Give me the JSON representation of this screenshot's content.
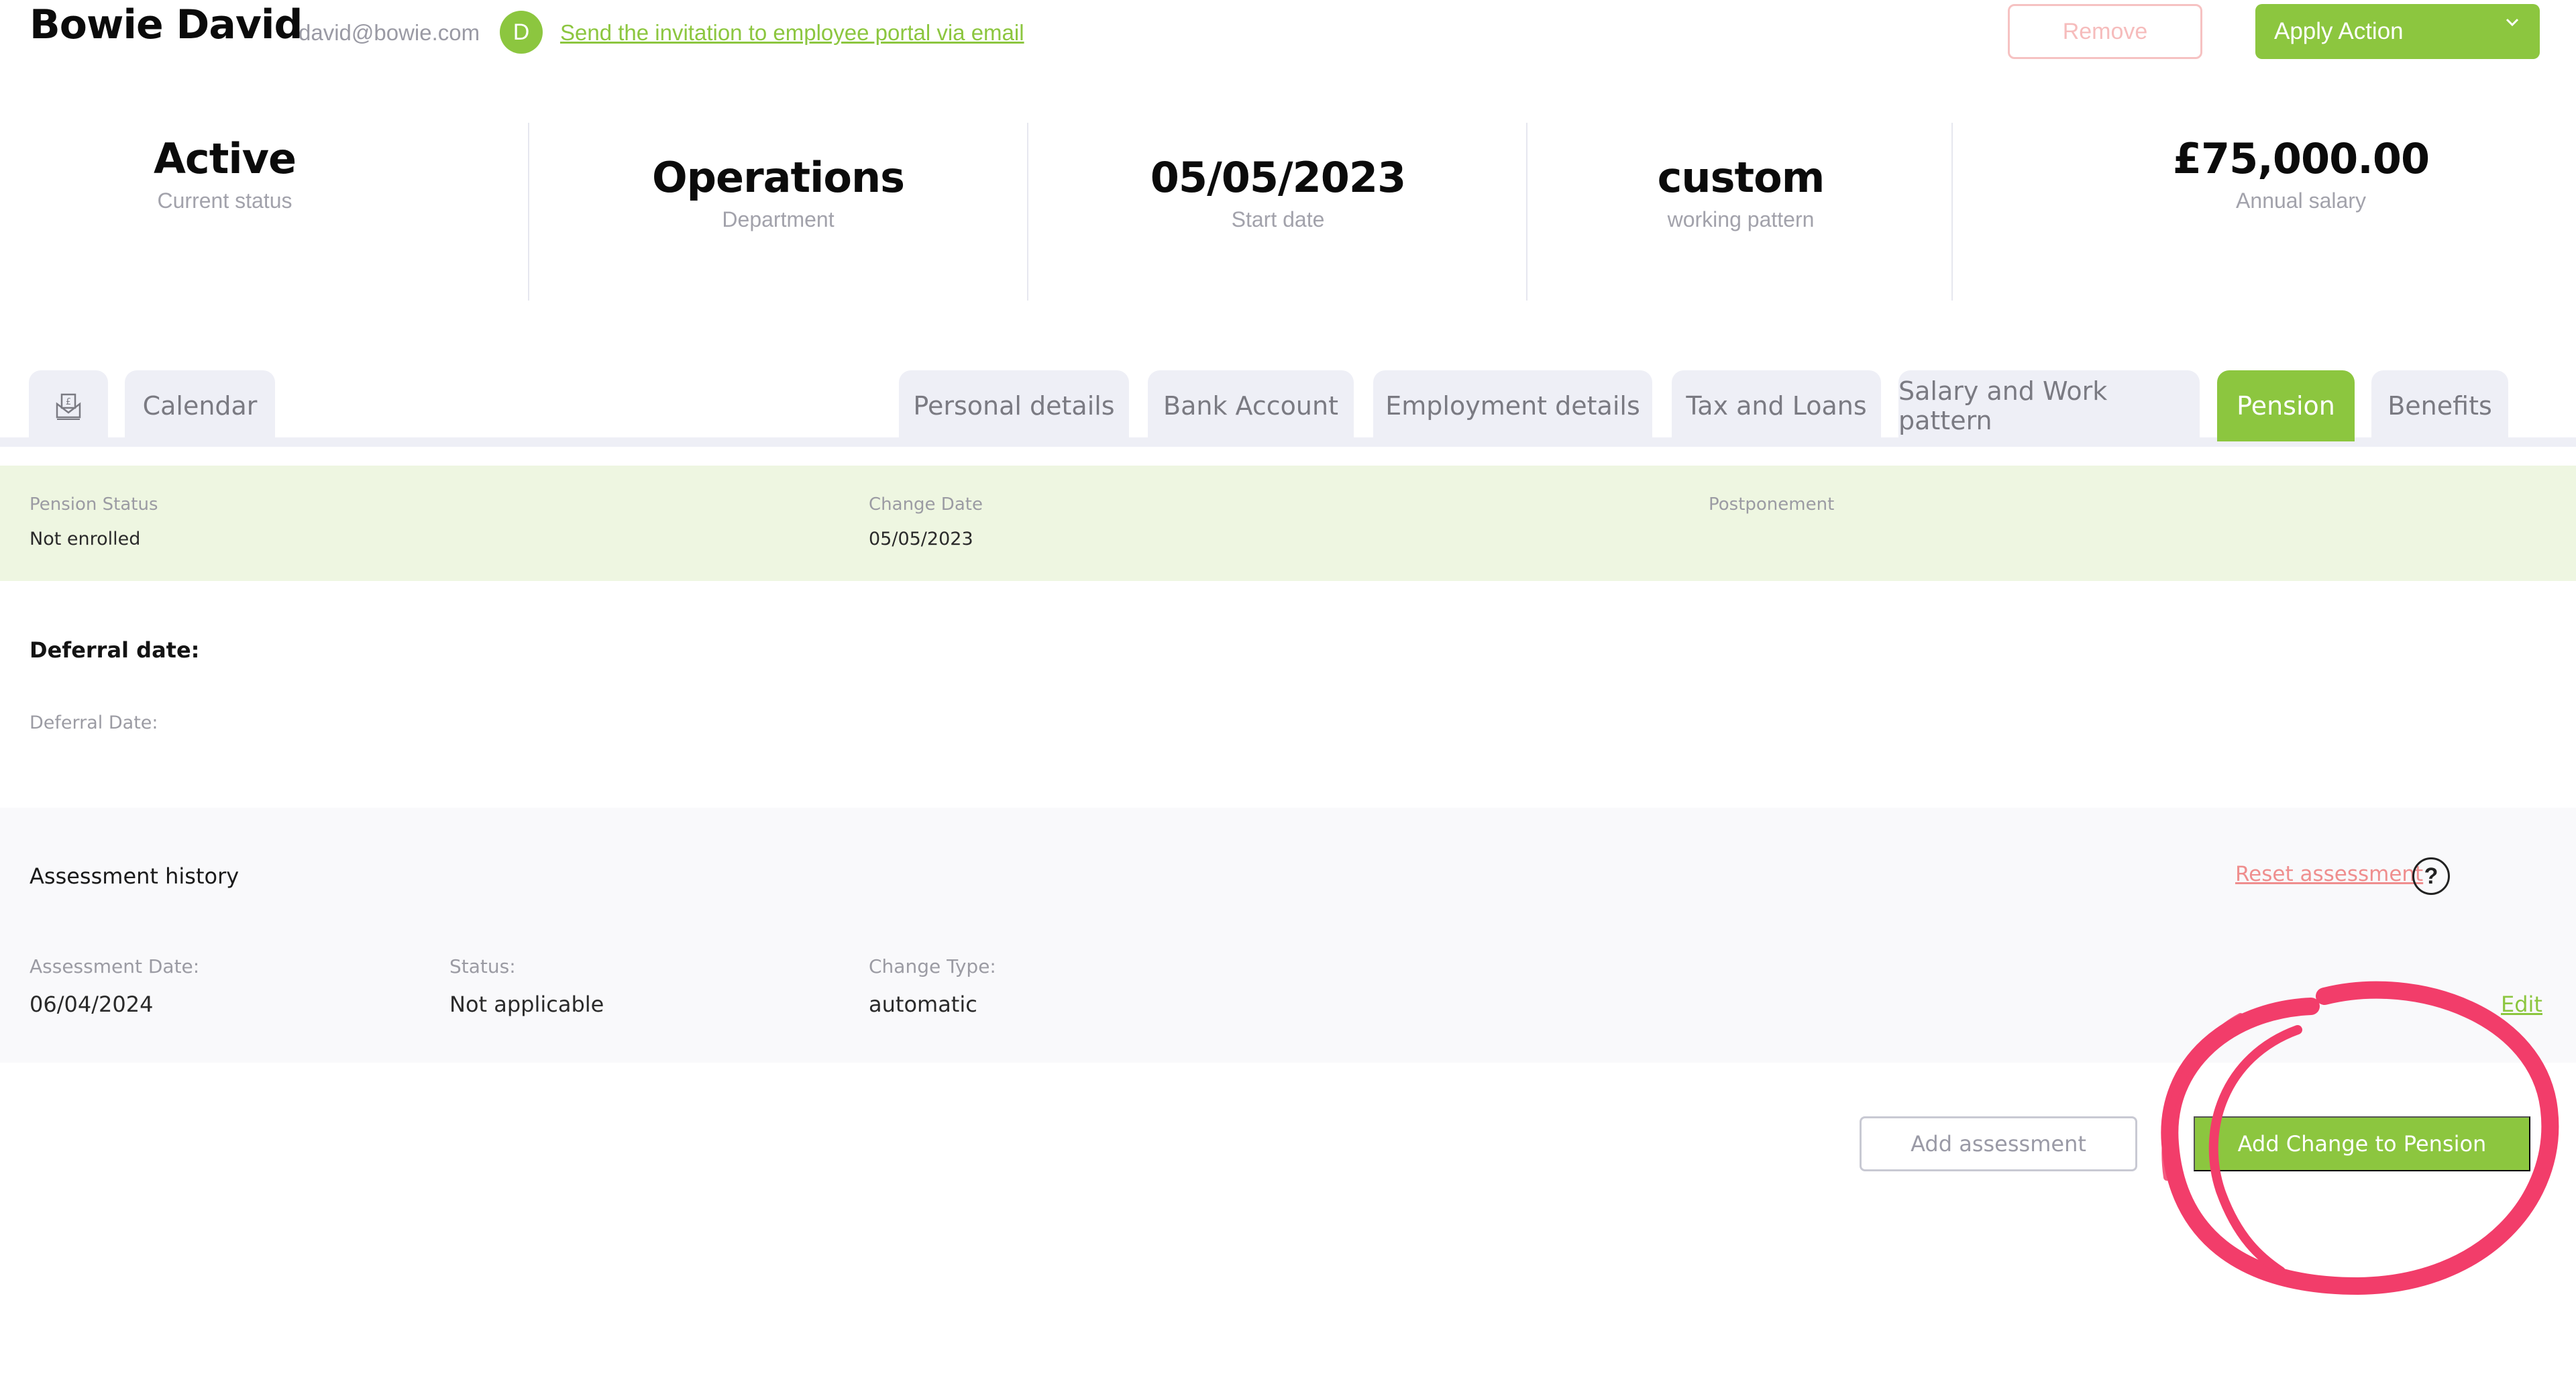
{
  "header": {
    "employee_name": "Bowie David",
    "email": "david@bowie.com",
    "avatar_initial": "D",
    "invite_link": "Send the invitation to employee portal via email",
    "remove_label": "Remove",
    "apply_action_label": "Apply Action"
  },
  "summary": [
    {
      "value": "Active",
      "label": "Current status"
    },
    {
      "value": "Operations",
      "label": "Department"
    },
    {
      "value": "05/05/2023",
      "label": "Start date"
    },
    {
      "value": "custom",
      "label": "working pattern"
    },
    {
      "value": "£75,000.00",
      "label": "Annual salary"
    }
  ],
  "tabs": {
    "payslip_icon": "payslip-envelope-pound-icon",
    "left": [
      {
        "label": "Calendar"
      }
    ],
    "right": [
      {
        "label": "Personal details"
      },
      {
        "label": "Bank Account"
      },
      {
        "label": "Employment details"
      },
      {
        "label": "Tax and Loans"
      },
      {
        "label": "Salary and Work pattern"
      },
      {
        "label": "Pension",
        "active": true
      },
      {
        "label": "Benefits"
      }
    ]
  },
  "pension_status": {
    "status_label": "Pension Status",
    "status_value": "Not enrolled",
    "change_date_label": "Change Date",
    "change_date_value": "05/05/2023",
    "postponement_label": "Postponement",
    "postponement_value": ""
  },
  "deferral": {
    "title": "Deferral date:",
    "field_label": "Deferral Date:",
    "field_value": ""
  },
  "assessment_history": {
    "title": "Assessment history",
    "reset_label": "Reset assessment",
    "help_icon": "question-circle-icon",
    "columns": [
      "Assessment Date:",
      "Status:",
      "Change Type:"
    ],
    "rows": [
      {
        "date": "06/04/2024",
        "status": "Not applicable",
        "change_type": "automatic",
        "edit_label": "Edit"
      }
    ]
  },
  "actions": {
    "add_assessment_label": "Add assessment",
    "add_change_label": "Add Change to Pension"
  },
  "colors": {
    "brand_green": "#8cc63f",
    "status_band": "#eef6e1",
    "remove_red": "#f6c2c2",
    "reset_link": "#ef8e8e",
    "annotation_pink": "#f23d6a"
  }
}
